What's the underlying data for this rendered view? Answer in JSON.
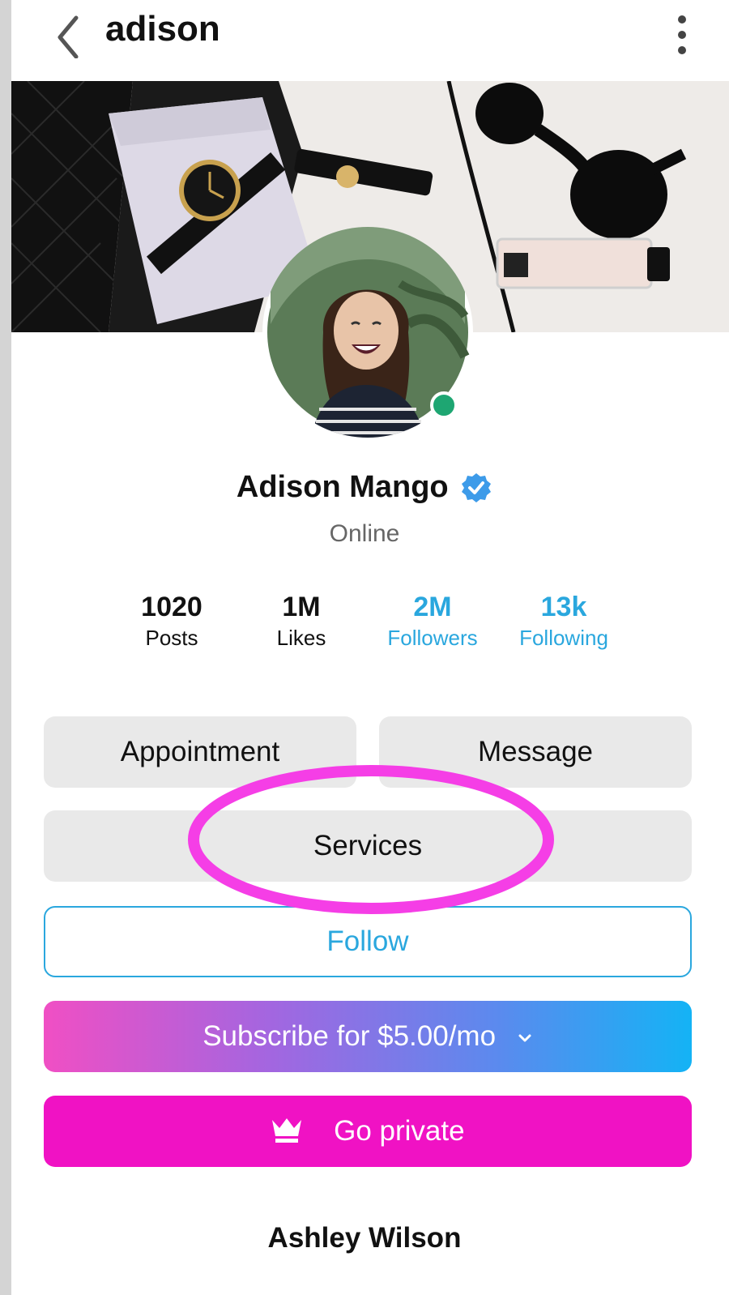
{
  "header": {
    "title": "adison",
    "back_icon": "chevron-left-icon",
    "menu_icon": "kebab-menu-icon"
  },
  "profile": {
    "name": "Adison Mango",
    "status": "Online",
    "verified": true,
    "online_color": "#1ea672"
  },
  "stats": [
    {
      "value": "1020",
      "label": "Posts"
    },
    {
      "value": "1M",
      "label": "Likes"
    },
    {
      "value": "2M",
      "label": "Followers"
    },
    {
      "value": "13k",
      "label": "Following"
    }
  ],
  "actions": {
    "appointment": "Appointment",
    "message": "Message",
    "services": "Services",
    "follow": "Follow",
    "subscribe": "Subscribe for $5.00/mo",
    "go_private": "Go private"
  },
  "bio": {
    "name": "Ashley Wilson"
  },
  "colors": {
    "accent_blue": "#2aa7de",
    "private_pink": "#f012c4",
    "annotation_magenta": "#f53ee6"
  }
}
